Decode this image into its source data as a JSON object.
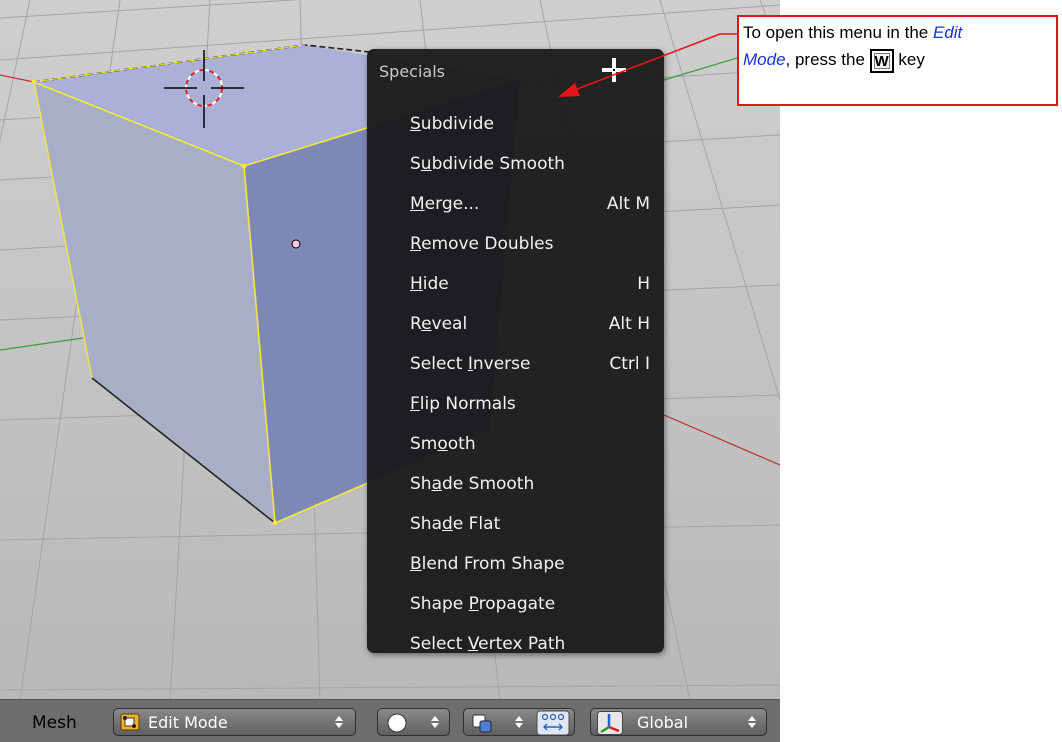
{
  "menu": {
    "title": "Specials",
    "items": [
      {
        "pre": "",
        "u": "S",
        "post": "ubdivide",
        "shortcut": ""
      },
      {
        "pre": "S",
        "u": "u",
        "post": "bdivide Smooth",
        "shortcut": ""
      },
      {
        "pre": "",
        "u": "M",
        "post": "erge...",
        "shortcut": "Alt M"
      },
      {
        "pre": "",
        "u": "R",
        "post": "emove Doubles",
        "shortcut": ""
      },
      {
        "pre": "",
        "u": "H",
        "post": "ide",
        "shortcut": "H"
      },
      {
        "pre": "R",
        "u": "e",
        "post": "veal",
        "shortcut": "Alt H"
      },
      {
        "pre": "Select ",
        "u": "I",
        "post": "nverse",
        "shortcut": "Ctrl I"
      },
      {
        "pre": "",
        "u": "F",
        "post": "lip Normals",
        "shortcut": ""
      },
      {
        "pre": "Sm",
        "u": "o",
        "post": "oth",
        "shortcut": ""
      },
      {
        "pre": "Sh",
        "u": "a",
        "post": "de Smooth",
        "shortcut": ""
      },
      {
        "pre": "Sha",
        "u": "d",
        "post": "e Flat",
        "shortcut": ""
      },
      {
        "pre": "",
        "u": "B",
        "post": "lend From Shape",
        "shortcut": ""
      },
      {
        "pre": "Shape ",
        "u": "P",
        "post": "ropagate",
        "shortcut": ""
      },
      {
        "pre": "Select ",
        "u": "V",
        "post": "ertex Path",
        "shortcut": ""
      }
    ]
  },
  "header": {
    "menu_label": "Mesh",
    "mode": "Edit Mode",
    "orientation": "Global"
  },
  "callout": {
    "text1": "To open this menu in the ",
    "link1": "Edit",
    "link2": "Mode",
    "text2": ", press the ",
    "key": "W",
    "text3": " key"
  },
  "colors": {
    "cube_top": "#aab0d6",
    "cube_left": "#a8aec6",
    "cube_front": "#7e88b6",
    "selected_edge": "#f4e83a",
    "callout_border": "#e8141a",
    "link": "#1533d9"
  }
}
